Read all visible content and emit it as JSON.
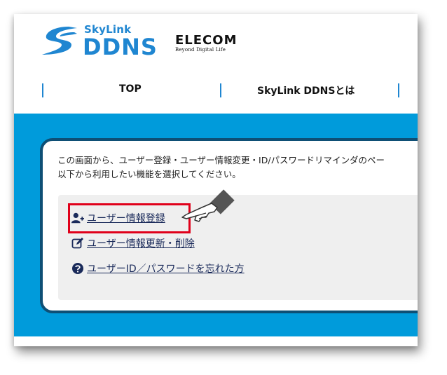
{
  "header": {
    "logo_sky": "SkyLink",
    "logo_ddns": "DDNS",
    "brand_name": "ELECOM",
    "brand_tagline": "Beyond Digital Life"
  },
  "nav": {
    "items": [
      {
        "label": "TOP"
      },
      {
        "label": "SkyLink DDNSとは"
      }
    ]
  },
  "content": {
    "intro_line1": "この画面から、ユーザー登録・ユーザー情報変更・ID/パスワードリマインダのペー",
    "intro_line2": "以下から利用したい機能を選択してください。",
    "links": [
      {
        "label": "ユーザー情報登録",
        "icon": "user-add-icon"
      },
      {
        "label": "ユーザー情報更新・削除",
        "icon": "edit-icon"
      },
      {
        "label": "ユーザーID／パスワードを忘れた方",
        "icon": "question-icon"
      }
    ]
  },
  "colors": {
    "brand_blue": "#1f86d1",
    "band_blue": "#009bdb",
    "card_border": "#0e4f75",
    "link_color": "#1a2a5a",
    "highlight_red": "#e0001a"
  }
}
